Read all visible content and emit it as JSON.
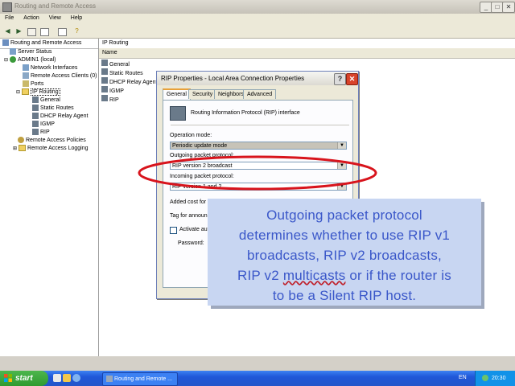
{
  "window": {
    "title": "Routing and Remote Access",
    "menu": [
      "File",
      "Action",
      "View",
      "Help"
    ],
    "controls": {
      "minimize": "_",
      "maximize": "□",
      "close": "✕"
    }
  },
  "tree": {
    "header": "Routing and Remote Access",
    "items": [
      {
        "label": "Server Status",
        "icon": "server-status-icon"
      },
      {
        "label": "ADMIN1 (local)",
        "icon": "server-icon"
      },
      {
        "label": "Network Interfaces",
        "icon": "network-interfaces-icon"
      },
      {
        "label": "Remote Access Clients (0)",
        "icon": "clients-icon"
      },
      {
        "label": "Ports",
        "icon": "ports-icon"
      },
      {
        "label": "IP Routing",
        "icon": "folder-icon"
      },
      {
        "label": "General",
        "icon": "router-icon"
      },
      {
        "label": "Static Routes",
        "icon": "router-icon"
      },
      {
        "label": "DHCP Relay Agent",
        "icon": "router-icon"
      },
      {
        "label": "IGMP",
        "icon": "router-icon"
      },
      {
        "label": "RIP",
        "icon": "router-icon"
      },
      {
        "label": "Remote Access Policies",
        "icon": "policy-icon"
      },
      {
        "label": "Remote Access Logging",
        "icon": "folder-icon"
      }
    ]
  },
  "list": {
    "header": "IP Routing",
    "column": "Name",
    "items": [
      "General",
      "Static Routes",
      "DHCP Relay Agent",
      "IGMP",
      "RIP"
    ]
  },
  "dialog": {
    "title": "RIP Properties - Local Area Connection Properties",
    "help": "?",
    "close": "✕",
    "tabs": [
      "General",
      "Security",
      "Neighbors",
      "Advanced"
    ],
    "interface_label": "Routing Information Protocol (RIP) interface",
    "operation_mode_label": "Operation mode:",
    "operation_mode_value": "Periodic update mode",
    "outgoing_label": "Outgoing packet protocol:",
    "outgoing_value": "RIP version 2 broadcast",
    "incoming_label": "Incoming packet protocol:",
    "incoming_value": "RIP version 1 and 2",
    "added_cost_label": "Added cost for ro",
    "tag_label": "Tag for announ",
    "activate_label": "Activate auth",
    "password_label": "Password:"
  },
  "callout": {
    "line1": "Outgoing packet protocol",
    "line2": "determines whether to use RIP v1",
    "line3": "broadcasts, RIP v2 broadcasts,",
    "line4_pre": "RIP v2 ",
    "line4_sq": "multicasts",
    "line4_post": " or if the router is",
    "line5": "to be a Silent RIP host."
  },
  "taskbar": {
    "start": "start",
    "task": "Routing and Remote ...",
    "lang": "EN",
    "time": "20:30"
  },
  "colors": {
    "highlight_ellipse": "#d8141c",
    "callout_text": "#3a57c9",
    "callout_bg": "#c8d6f2"
  }
}
